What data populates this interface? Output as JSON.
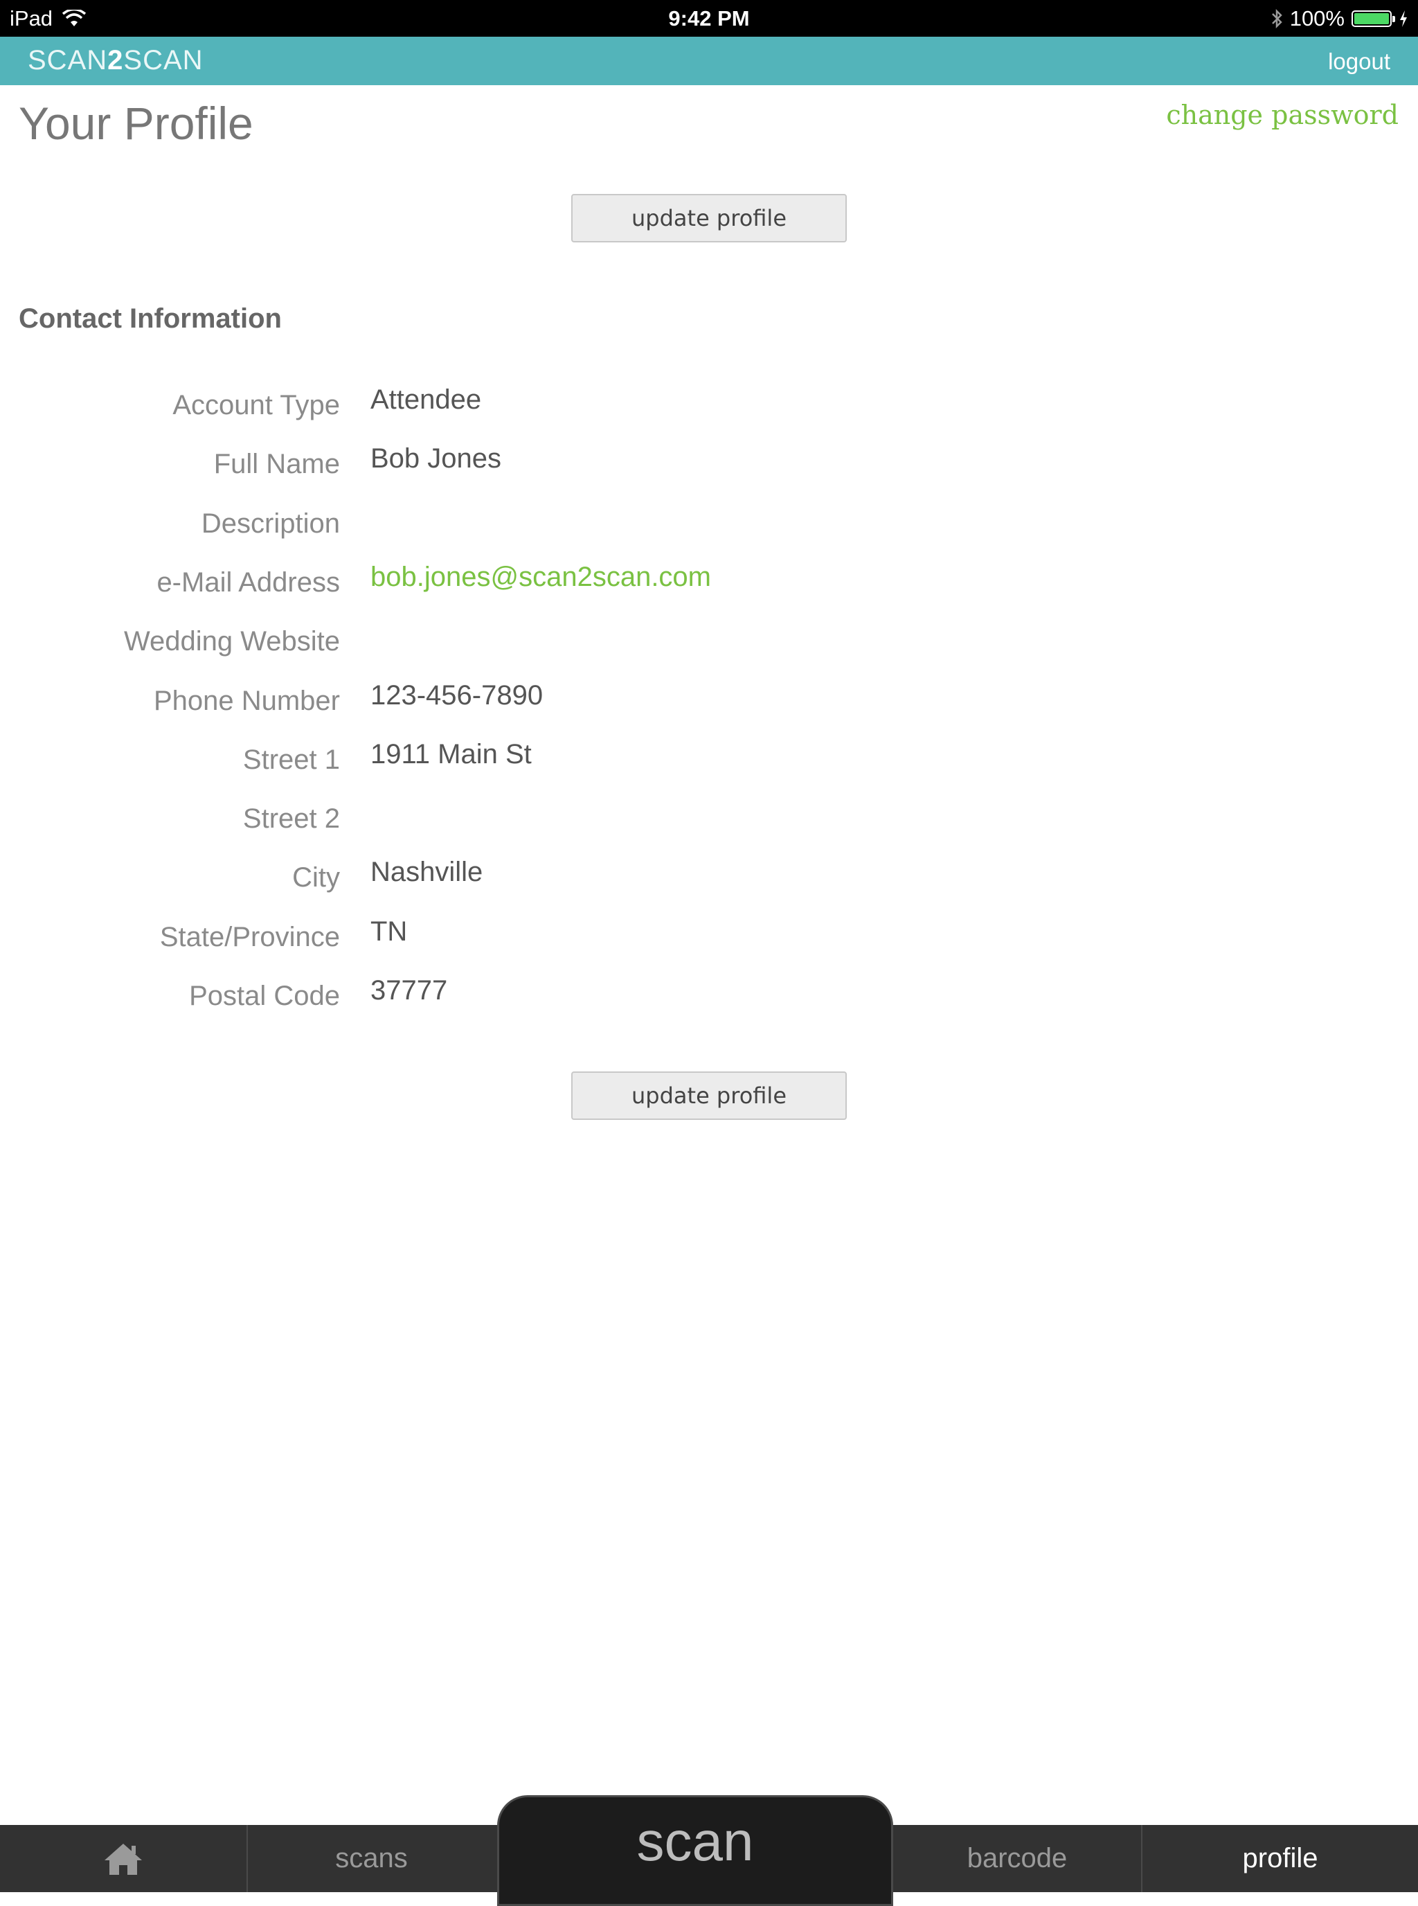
{
  "status_bar": {
    "device": "iPad",
    "time": "9:42 PM",
    "battery": "100%",
    "battery_level": 1.0
  },
  "app_bar": {
    "brand_prefix": "SCAN",
    "brand_mid": "2",
    "brand_suffix": "SCAN",
    "logout_label": "logout"
  },
  "page": {
    "title": "Your Profile",
    "change_password_label": "change password",
    "update_button_label": "update profile"
  },
  "contact": {
    "section_title": "Contact Information",
    "fields": [
      {
        "label": "Account Type",
        "value": "Attendee"
      },
      {
        "label": "Full Name",
        "value": "Bob Jones"
      },
      {
        "label": "Description",
        "value": ""
      },
      {
        "label": "e-Mail Address",
        "value": "bob.jones@scan2scan.com"
      },
      {
        "label": "Wedding Website",
        "value": ""
      },
      {
        "label": "Phone Number",
        "value": "123-456-7890"
      },
      {
        "label": "Street 1",
        "value": "1911 Main St"
      },
      {
        "label": "Street 2",
        "value": ""
      },
      {
        "label": "City",
        "value": "Nashville"
      },
      {
        "label": "State/Province",
        "value": "TN"
      },
      {
        "label": "Postal Code",
        "value": "37777"
      }
    ]
  },
  "tabbar": {
    "home_icon": "home-icon",
    "scans_label": "scans",
    "scan_label": "scan",
    "barcode_label": "barcode",
    "profile_label": "profile",
    "active_tab": "profile"
  },
  "colors": {
    "header_bg": "#53b4ba",
    "accent_green": "#7ac142",
    "tabbar_bg": "#323232"
  }
}
